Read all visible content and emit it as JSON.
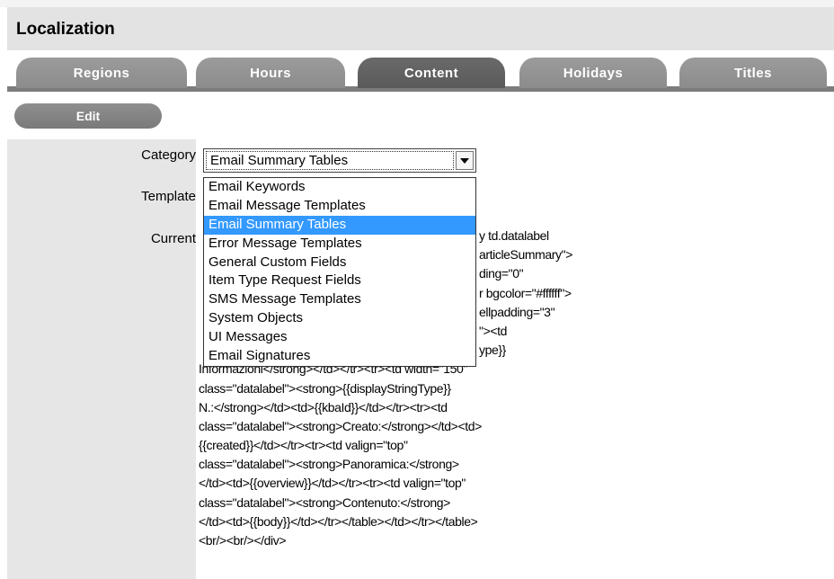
{
  "page": {
    "title": "Localization"
  },
  "tabs": [
    {
      "label": "Regions",
      "active": false
    },
    {
      "label": "Hours",
      "active": false
    },
    {
      "label": "Content",
      "active": true
    },
    {
      "label": "Holidays",
      "active": false
    },
    {
      "label": "Titles",
      "active": false
    }
  ],
  "toolbar": {
    "edit_label": "Edit"
  },
  "form": {
    "category_label": "Category",
    "template_label": "Template",
    "current_label": "Current",
    "category_value": "Email Summary Tables"
  },
  "dropdown": {
    "options": [
      "Email Keywords",
      "Email Message Templates",
      "Email Summary Tables",
      "Error Message Templates",
      "General Custom Fields",
      "Item Type Request Fields",
      "SMS Message Templates",
      "System Objects",
      "UI Messages",
      "Email Signatures"
    ],
    "selected_index": 2
  },
  "content_lines": [
    "y td.datalabel",
    "articleSummary\">",
    "ding=\"0\"",
    "r bgcolor=\"#ffffff\">",
    "ellpadding=\"3\"",
    "\"><td",
    "ype}}",
    "Informazioni</strong></td></tr><tr><td width=\"150\"",
    "class=\"datalabel\"><strong>{{displayStringType}}",
    "N.:</strong></td><td>{{kbaId}}</td></tr><tr><td",
    "class=\"datalabel\"><strong>Creato:</strong></td><td>",
    "{{created}}</td></tr><tr><td valign=\"top\"",
    "class=\"datalabel\"><strong>Panoramica:</strong>",
    "</td><td>{{overview}}</td></tr><tr><td valign=\"top\"",
    "class=\"datalabel\"><strong>Contenuto:</strong>",
    "</td><td>{{body}}</td></tr></table></td></tr></table>",
    "<br/><br/></div>"
  ]
}
